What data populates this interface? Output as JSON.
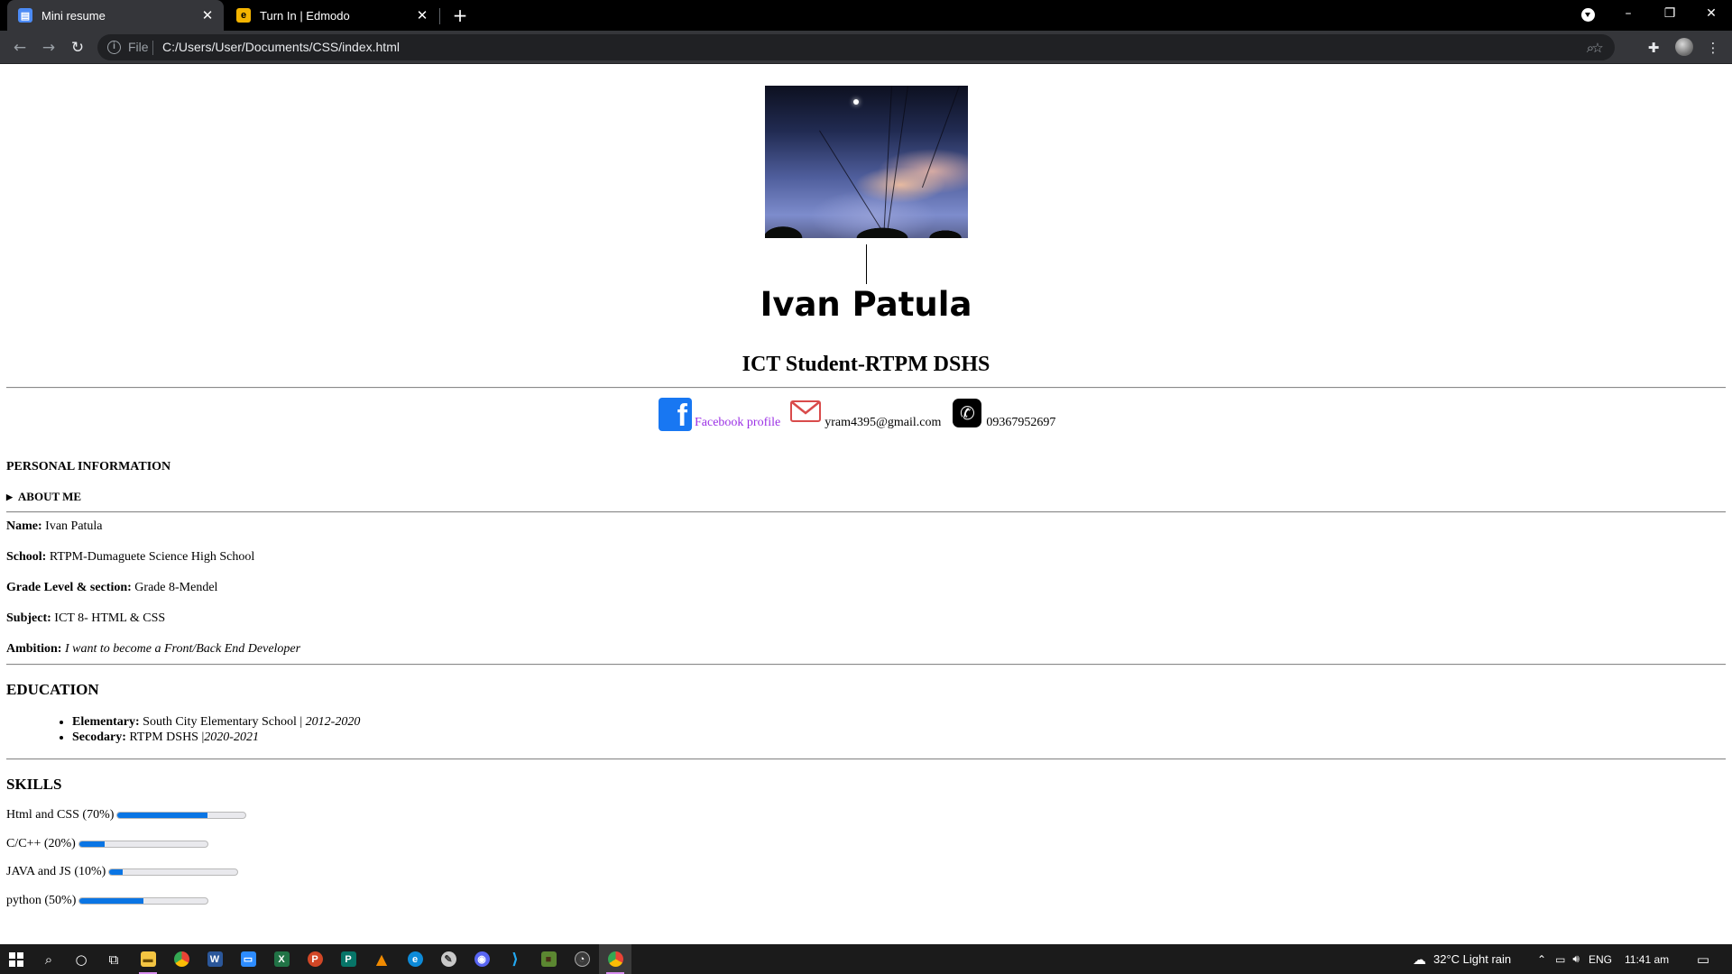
{
  "browser": {
    "tabs": [
      {
        "title": "Mini resume",
        "favicon": "document-icon",
        "active": true
      },
      {
        "title": "Turn In | Edmodo",
        "favicon": "edmodo-icon",
        "active": false
      }
    ],
    "address_scheme_label": "File",
    "url": "C:/Users/User/Documents/CSS/index.html"
  },
  "resume": {
    "photo": "sky-photo",
    "name": "Ivan Patula",
    "subtitle": "ICT Student-RTPM DSHS",
    "contacts": {
      "facebook_label": "Facebook profile",
      "email": "yram4395@gmail.com",
      "phone": "09367952697"
    },
    "personal_info": {
      "heading": "PERSONAL INFORMATION",
      "about_toggle": "ABOUT ME",
      "fields": [
        {
          "label": "Name:",
          "value": "Ivan Patula"
        },
        {
          "label": "School:",
          "value": "RTPM-Dumaguete Science High School"
        },
        {
          "label": "Grade Level & section:",
          "value": "Grade 8-Mendel"
        },
        {
          "label": "Subject:",
          "value": "ICT 8- HTML & CSS"
        },
        {
          "label": "Ambition:",
          "value": "I want to become a Front/Back End Developer"
        }
      ]
    },
    "education": {
      "heading": "EDUCATION",
      "items": [
        {
          "label": "Elementary:",
          "school": "South City Elementary School | ",
          "years": "2012-2020"
        },
        {
          "label": "Secodary:",
          "school": "RTPM DSHS |",
          "years": "2020-2021"
        }
      ]
    },
    "skills": {
      "heading": "SKILLS",
      "items": [
        {
          "label": "Html and CSS (70%)",
          "progress": 0.7
        },
        {
          "label": "C/C++ (20%)",
          "progress": 0.2
        },
        {
          "label": "JAVA and JS (10%)",
          "progress": 0.1
        },
        {
          "label": "python (50%)",
          "progress": 0.5
        }
      ]
    }
  },
  "taskbar": {
    "apps": [
      "file-explorer",
      "chrome",
      "word",
      "zoom",
      "excel",
      "powerpoint",
      "publisher",
      "vlc",
      "edge",
      "paint-3d",
      "discord",
      "vscode",
      "minecraft",
      "obs",
      "chrome-active"
    ],
    "weather": "32°C  Light rain",
    "language": "ENG",
    "time": "11:41 am"
  },
  "colors": {
    "accent_progress": "#0a75e4",
    "link_visited": "#9b30e5",
    "facebook_blue": "#1877f2",
    "browser_dark": "#35363a"
  }
}
